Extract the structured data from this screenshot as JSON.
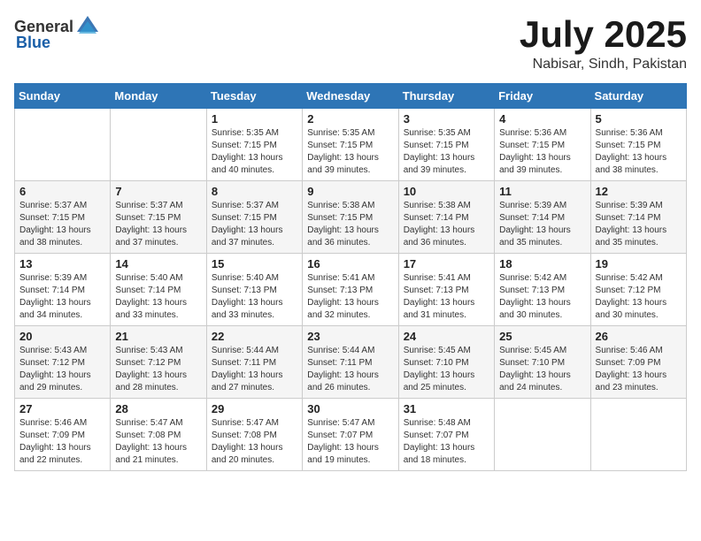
{
  "header": {
    "logo_general": "General",
    "logo_blue": "Blue",
    "month": "July 2025",
    "location": "Nabisar, Sindh, Pakistan"
  },
  "calendar": {
    "days_of_week": [
      "Sunday",
      "Monday",
      "Tuesday",
      "Wednesday",
      "Thursday",
      "Friday",
      "Saturday"
    ],
    "weeks": [
      [
        {
          "day": "",
          "info": ""
        },
        {
          "day": "",
          "info": ""
        },
        {
          "day": "1",
          "sunrise": "Sunrise: 5:35 AM",
          "sunset": "Sunset: 7:15 PM",
          "daylight": "Daylight: 13 hours and 40 minutes."
        },
        {
          "day": "2",
          "sunrise": "Sunrise: 5:35 AM",
          "sunset": "Sunset: 7:15 PM",
          "daylight": "Daylight: 13 hours and 39 minutes."
        },
        {
          "day": "3",
          "sunrise": "Sunrise: 5:35 AM",
          "sunset": "Sunset: 7:15 PM",
          "daylight": "Daylight: 13 hours and 39 minutes."
        },
        {
          "day": "4",
          "sunrise": "Sunrise: 5:36 AM",
          "sunset": "Sunset: 7:15 PM",
          "daylight": "Daylight: 13 hours and 39 minutes."
        },
        {
          "day": "5",
          "sunrise": "Sunrise: 5:36 AM",
          "sunset": "Sunset: 7:15 PM",
          "daylight": "Daylight: 13 hours and 38 minutes."
        }
      ],
      [
        {
          "day": "6",
          "sunrise": "Sunrise: 5:37 AM",
          "sunset": "Sunset: 7:15 PM",
          "daylight": "Daylight: 13 hours and 38 minutes."
        },
        {
          "day": "7",
          "sunrise": "Sunrise: 5:37 AM",
          "sunset": "Sunset: 7:15 PM",
          "daylight": "Daylight: 13 hours and 37 minutes."
        },
        {
          "day": "8",
          "sunrise": "Sunrise: 5:37 AM",
          "sunset": "Sunset: 7:15 PM",
          "daylight": "Daylight: 13 hours and 37 minutes."
        },
        {
          "day": "9",
          "sunrise": "Sunrise: 5:38 AM",
          "sunset": "Sunset: 7:15 PM",
          "daylight": "Daylight: 13 hours and 36 minutes."
        },
        {
          "day": "10",
          "sunrise": "Sunrise: 5:38 AM",
          "sunset": "Sunset: 7:14 PM",
          "daylight": "Daylight: 13 hours and 36 minutes."
        },
        {
          "day": "11",
          "sunrise": "Sunrise: 5:39 AM",
          "sunset": "Sunset: 7:14 PM",
          "daylight": "Daylight: 13 hours and 35 minutes."
        },
        {
          "day": "12",
          "sunrise": "Sunrise: 5:39 AM",
          "sunset": "Sunset: 7:14 PM",
          "daylight": "Daylight: 13 hours and 35 minutes."
        }
      ],
      [
        {
          "day": "13",
          "sunrise": "Sunrise: 5:39 AM",
          "sunset": "Sunset: 7:14 PM",
          "daylight": "Daylight: 13 hours and 34 minutes."
        },
        {
          "day": "14",
          "sunrise": "Sunrise: 5:40 AM",
          "sunset": "Sunset: 7:14 PM",
          "daylight": "Daylight: 13 hours and 33 minutes."
        },
        {
          "day": "15",
          "sunrise": "Sunrise: 5:40 AM",
          "sunset": "Sunset: 7:13 PM",
          "daylight": "Daylight: 13 hours and 33 minutes."
        },
        {
          "day": "16",
          "sunrise": "Sunrise: 5:41 AM",
          "sunset": "Sunset: 7:13 PM",
          "daylight": "Daylight: 13 hours and 32 minutes."
        },
        {
          "day": "17",
          "sunrise": "Sunrise: 5:41 AM",
          "sunset": "Sunset: 7:13 PM",
          "daylight": "Daylight: 13 hours and 31 minutes."
        },
        {
          "day": "18",
          "sunrise": "Sunrise: 5:42 AM",
          "sunset": "Sunset: 7:13 PM",
          "daylight": "Daylight: 13 hours and 30 minutes."
        },
        {
          "day": "19",
          "sunrise": "Sunrise: 5:42 AM",
          "sunset": "Sunset: 7:12 PM",
          "daylight": "Daylight: 13 hours and 30 minutes."
        }
      ],
      [
        {
          "day": "20",
          "sunrise": "Sunrise: 5:43 AM",
          "sunset": "Sunset: 7:12 PM",
          "daylight": "Daylight: 13 hours and 29 minutes."
        },
        {
          "day": "21",
          "sunrise": "Sunrise: 5:43 AM",
          "sunset": "Sunset: 7:12 PM",
          "daylight": "Daylight: 13 hours and 28 minutes."
        },
        {
          "day": "22",
          "sunrise": "Sunrise: 5:44 AM",
          "sunset": "Sunset: 7:11 PM",
          "daylight": "Daylight: 13 hours and 27 minutes."
        },
        {
          "day": "23",
          "sunrise": "Sunrise: 5:44 AM",
          "sunset": "Sunset: 7:11 PM",
          "daylight": "Daylight: 13 hours and 26 minutes."
        },
        {
          "day": "24",
          "sunrise": "Sunrise: 5:45 AM",
          "sunset": "Sunset: 7:10 PM",
          "daylight": "Daylight: 13 hours and 25 minutes."
        },
        {
          "day": "25",
          "sunrise": "Sunrise: 5:45 AM",
          "sunset": "Sunset: 7:10 PM",
          "daylight": "Daylight: 13 hours and 24 minutes."
        },
        {
          "day": "26",
          "sunrise": "Sunrise: 5:46 AM",
          "sunset": "Sunset: 7:09 PM",
          "daylight": "Daylight: 13 hours and 23 minutes."
        }
      ],
      [
        {
          "day": "27",
          "sunrise": "Sunrise: 5:46 AM",
          "sunset": "Sunset: 7:09 PM",
          "daylight": "Daylight: 13 hours and 22 minutes."
        },
        {
          "day": "28",
          "sunrise": "Sunrise: 5:47 AM",
          "sunset": "Sunset: 7:08 PM",
          "daylight": "Daylight: 13 hours and 21 minutes."
        },
        {
          "day": "29",
          "sunrise": "Sunrise: 5:47 AM",
          "sunset": "Sunset: 7:08 PM",
          "daylight": "Daylight: 13 hours and 20 minutes."
        },
        {
          "day": "30",
          "sunrise": "Sunrise: 5:47 AM",
          "sunset": "Sunset: 7:07 PM",
          "daylight": "Daylight: 13 hours and 19 minutes."
        },
        {
          "day": "31",
          "sunrise": "Sunrise: 5:48 AM",
          "sunset": "Sunset: 7:07 PM",
          "daylight": "Daylight: 13 hours and 18 minutes."
        },
        {
          "day": "",
          "info": ""
        },
        {
          "day": "",
          "info": ""
        }
      ]
    ]
  }
}
